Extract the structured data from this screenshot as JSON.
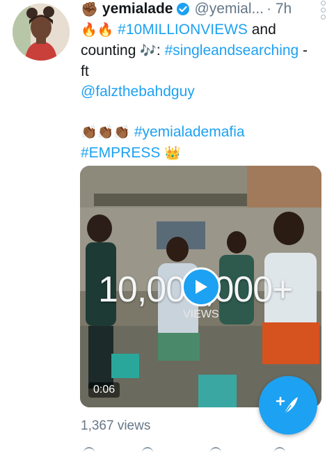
{
  "tweet": {
    "display_name": "yemialade",
    "handle": "@yemial...",
    "time": "· 7h",
    "prefix_emoji": "✊🏾",
    "lines": {
      "l1_emoji": "🔥🔥",
      "l1_hashtag": "#10MILLIONVIEWS",
      "l1_tail": " and",
      "l2_text": "counting ",
      "l2_emoji": "🎶",
      "l2_colon": ": ",
      "l2_hashtag": "#singleandsearching",
      "l2_tail": " -",
      "l3_text": "ft",
      "l4_mention": "@falzthebahdguy",
      "l5_emoji": "👏🏾👏🏾👏🏾",
      "l5_hashtag": "#yemialademafia",
      "l6_hashtag": "#EMPRESS",
      "l6_emoji": "👑"
    },
    "media": {
      "overlay_text": "10,000,000+",
      "overlay_sub": "VIEWS",
      "duration": "0:06"
    },
    "views": "1,367 views"
  },
  "icons": {
    "verified": "verified-badge-icon",
    "more": "more-options-icon",
    "play": "play-icon",
    "compose": "compose-tweet-icon"
  },
  "colors": {
    "accent": "#1da1f2",
    "secondary_text": "#657786",
    "primary_text": "#14171a"
  }
}
